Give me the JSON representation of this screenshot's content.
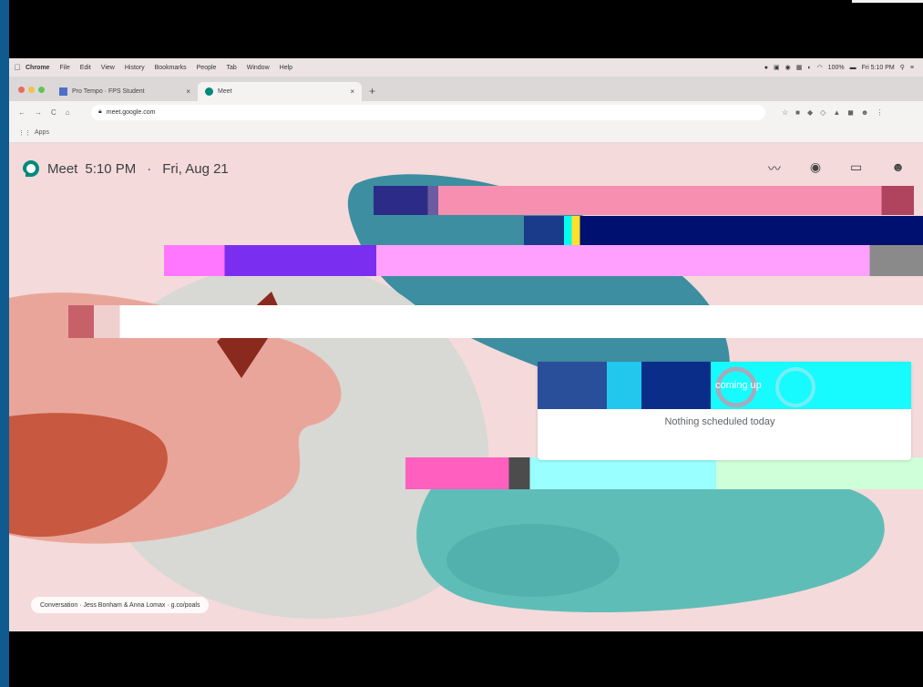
{
  "menubar": {
    "app": "Chrome",
    "items": [
      "File",
      "Edit",
      "View",
      "History",
      "Bookmarks",
      "People",
      "Tab",
      "Window",
      "Help"
    ],
    "battery": "100%",
    "clock": "Fri 5:10 PM"
  },
  "tabs": [
    {
      "label": "Pro Tempo · FPS Student",
      "active": false
    },
    {
      "label": "Meet",
      "active": true
    }
  ],
  "toolbar": {
    "url": "meet.google.com"
  },
  "bookmarks": {
    "apps_label": "Apps"
  },
  "meet": {
    "app_name": "Meet",
    "time": "5:10 PM",
    "separator": "·",
    "date": "Fri, Aug 21",
    "upcoming_title": "coming up",
    "nothing_scheduled": "Nothing scheduled today",
    "caption": "Conversation · Jess Bonham & Anna Lomax · g.co/poals"
  },
  "colors": {
    "page_bg": "#f4dada",
    "teal_blob": "#3d8ea0",
    "aqua_blob": "#5fbdb8",
    "salmon_blob": "#eaa59a",
    "rust_blob": "#c8583f",
    "grey_blob": "#d8d8d4"
  }
}
